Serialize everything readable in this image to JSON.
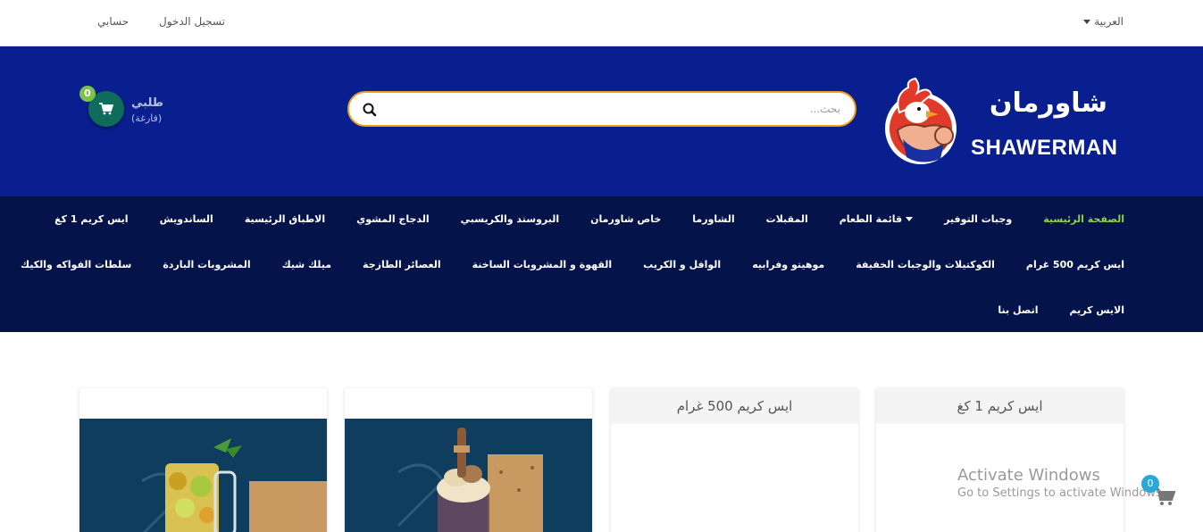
{
  "topbar": {
    "language": "العربية",
    "login": "تسجيل الدخول",
    "account": "حسابي"
  },
  "header": {
    "logo_ar": "شاورمان",
    "logo_en": "SHAWERMAN",
    "search_placeholder": "بحث...",
    "cart": {
      "title": "طلبي",
      "status": "(فارغة)",
      "count": "0"
    }
  },
  "nav": {
    "row1": [
      {
        "label": "الصفحة الرئيسية",
        "active": true
      },
      {
        "label": "وجبات التوفير"
      },
      {
        "label": "قائمة الطعام",
        "dropdown": true
      },
      {
        "label": "المقبلات"
      },
      {
        "label": "الشاورما"
      },
      {
        "label": "خاص شاورمان"
      },
      {
        "label": "البروستد والكريسبي"
      },
      {
        "label": "الدجاج المشوي"
      },
      {
        "label": "الاطباق الرئيسية"
      },
      {
        "label": "الساندويش"
      },
      {
        "label": "ايس كريم 1 كغ"
      }
    ],
    "row2": [
      {
        "label": "ايس كريم 500 غرام"
      },
      {
        "label": "الكوكتيلات والوجبات الخفيفة"
      },
      {
        "label": "موهيتو وفرابيه"
      },
      {
        "label": "الوافل و الكريب"
      },
      {
        "label": "القهوة و المشروبات الساخنة"
      },
      {
        "label": "العصائر الطازجة"
      },
      {
        "label": "ميلك شيك"
      },
      {
        "label": "المشروبات الباردة"
      },
      {
        "label": "سلطات الفواكه والكيك"
      }
    ],
    "row3": [
      {
        "label": "الايس كريم"
      },
      {
        "label": "اتصل بنا"
      }
    ]
  },
  "cards": [
    {
      "title": "ايس كريم 1 كغ"
    },
    {
      "title": "ايس كريم 500 غرام"
    },
    {
      "title": ""
    },
    {
      "title": ""
    }
  ],
  "watermark": {
    "line1": "Activate Windows",
    "line2": "Go to Settings to activate Windows."
  },
  "floating_cart": {
    "count": "0"
  },
  "colors": {
    "header_bg": "#0a1f8f",
    "nav_bg": "#04144a",
    "active_nav": "#8fd14f",
    "search_border": "#f0a020",
    "cart_badge": "#7cc24a"
  }
}
